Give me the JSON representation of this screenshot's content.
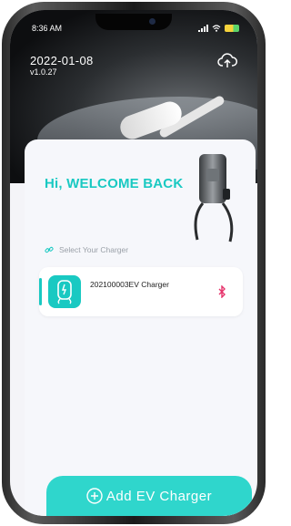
{
  "status_bar": {
    "time": "8:36 AM"
  },
  "header": {
    "date": "2022-01-08",
    "version": "v1.0.27"
  },
  "welcome": {
    "title": "Hi, WELCOME BACK"
  },
  "select": {
    "label": "Select Your Charger"
  },
  "chargers": [
    {
      "name": "202100003EV Charger",
      "connection": "bluetooth-icon"
    }
  ],
  "actions": {
    "add_label": "Add EV Charger"
  },
  "colors": {
    "accent": "#19c9c2",
    "button": "#2fd6cc",
    "bluetooth": "#e6336b"
  }
}
